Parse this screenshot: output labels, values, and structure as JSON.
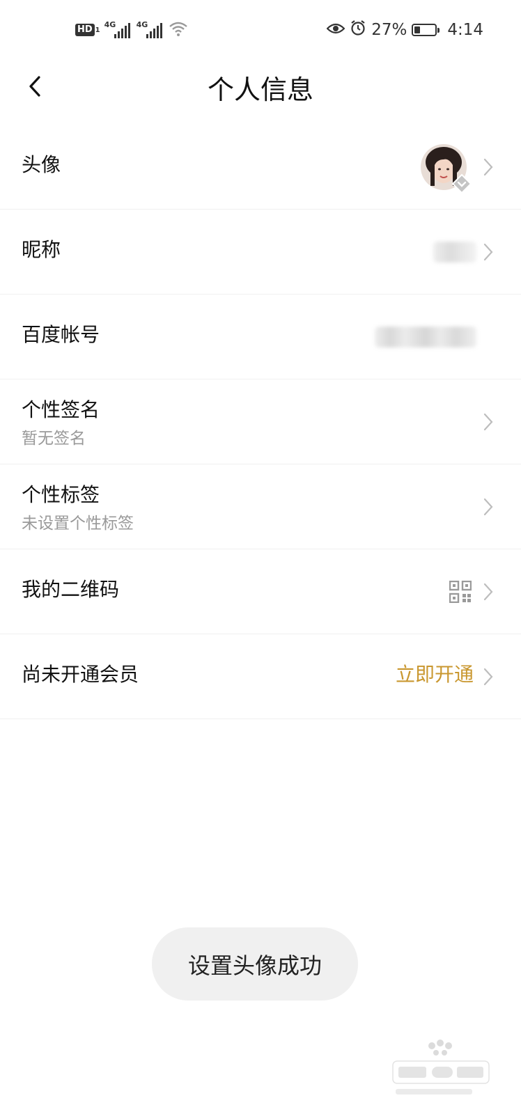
{
  "status_bar": {
    "hd_label": "HD",
    "hd_sub": "1",
    "network_1": "4G",
    "network_2": "4G",
    "battery_percent": "27%",
    "battery_level": 0.27,
    "time": "4:14",
    "icons": [
      "eye-icon",
      "alarm-icon",
      "wifi-icon",
      "battery-icon"
    ]
  },
  "header": {
    "title": "个人信息",
    "back_icon": "chevron-left-icon"
  },
  "rows": [
    {
      "label": "头像",
      "value_type": "avatar"
    },
    {
      "label": "昵称",
      "value_type": "blurred"
    },
    {
      "label": "百度帐号",
      "value_type": "blurred"
    },
    {
      "label": "个性签名",
      "sub": "暂无签名"
    },
    {
      "label": "个性标签",
      "sub": "未设置个性标签"
    },
    {
      "label": "我的二维码",
      "value_type": "qr-code-icon"
    },
    {
      "label": "尚未开通会员",
      "value": "立即开通"
    }
  ],
  "toast": {
    "text": "设置头像成功"
  },
  "colors": {
    "accent_gold": "#c9972f",
    "secondary_text": "#999999",
    "toast_bg": "#f0f0f0"
  }
}
